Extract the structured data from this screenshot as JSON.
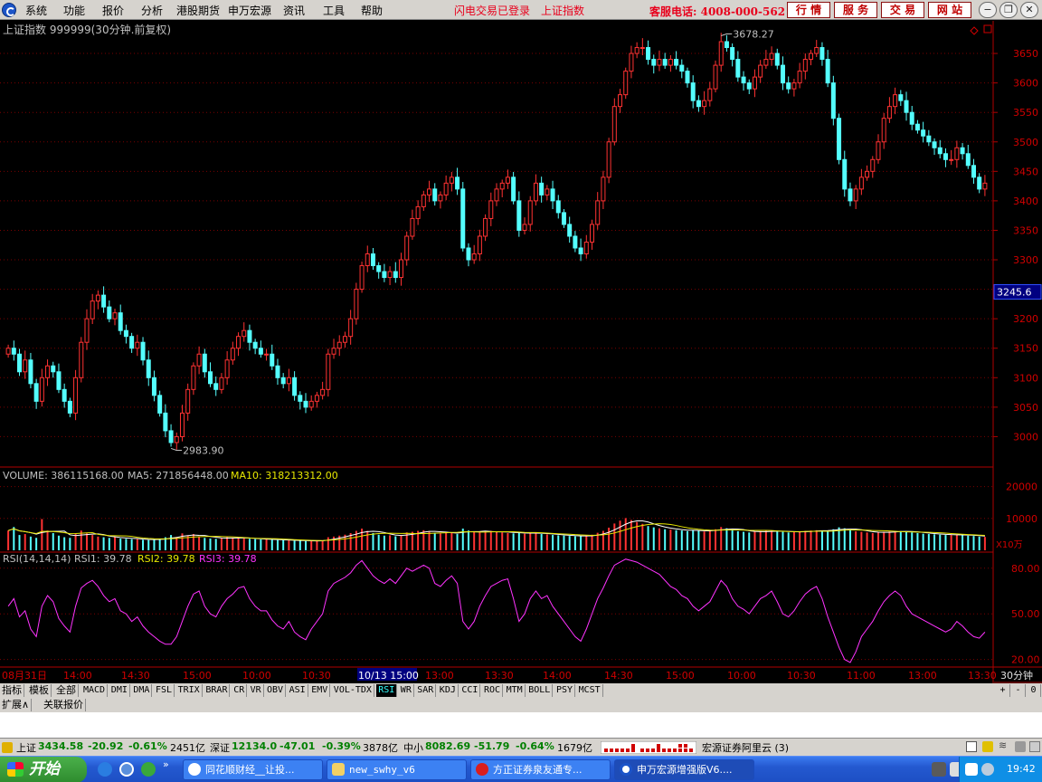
{
  "menubar": {
    "items": [
      "系统",
      "功能",
      "报价",
      "分析",
      "港股期货",
      "申万宏源",
      "资讯",
      "工具",
      "帮助"
    ],
    "flash_login": "闪电交易已登录",
    "index_link": "上证指数",
    "hotline": "客服电话: 4008-000-562",
    "buttons": [
      "行 情",
      "服 务",
      "交 易",
      "网 站"
    ]
  },
  "chart_header": {
    "title": "上证指数 999999(30分钟.前复权)"
  },
  "chart_data": {
    "type": "candlestick",
    "ylim": [
      2950,
      3690
    ],
    "yticks": [
      3650,
      3600,
      3550,
      3500,
      3450,
      3400,
      3350,
      3300,
      3250,
      3200,
      3150,
      3100,
      3050,
      3000
    ],
    "current_value_label": "3245.6",
    "max_label": "3678.27",
    "min_label": "2983.90",
    "x_tick_labels": [
      "08月31日",
      "14:00",
      "14:30",
      "15:00",
      "10:00",
      "10:30",
      "10/13 15:00",
      "13:00",
      "13:30",
      "14:00",
      "14:30",
      "15:00",
      "10:00",
      "10:30",
      "11:00",
      "13:00",
      "13:30"
    ],
    "closes": [
      3150,
      3140,
      3110,
      3130,
      3090,
      3060,
      3100,
      3120,
      3110,
      3080,
      3060,
      3040,
      3100,
      3160,
      3200,
      3230,
      3240,
      3220,
      3200,
      3210,
      3180,
      3170,
      3150,
      3160,
      3130,
      3100,
      3070,
      3040,
      3010,
      2990,
      3000,
      3040,
      3080,
      3120,
      3140,
      3110,
      3090,
      3080,
      3100,
      3130,
      3150,
      3170,
      3180,
      3160,
      3150,
      3140,
      3140,
      3120,
      3100,
      3090,
      3100,
      3070,
      3060,
      3050,
      3060,
      3070,
      3080,
      3140,
      3150,
      3160,
      3170,
      3200,
      3250,
      3290,
      3310,
      3290,
      3280,
      3270,
      3280,
      3270,
      3300,
      3340,
      3370,
      3390,
      3410,
      3420,
      3400,
      3410,
      3430,
      3440,
      3420,
      3320,
      3300,
      3310,
      3340,
      3370,
      3400,
      3420,
      3430,
      3440,
      3400,
      3350,
      3360,
      3400,
      3430,
      3410,
      3420,
      3400,
      3380,
      3360,
      3340,
      3320,
      3310,
      3330,
      3360,
      3400,
      3440,
      3500,
      3560,
      3580,
      3620,
      3650,
      3660,
      3660,
      3640,
      3630,
      3640,
      3630,
      3640,
      3630,
      3620,
      3600,
      3570,
      3560,
      3570,
      3590,
      3630,
      3670,
      3660,
      3640,
      3610,
      3600,
      3590,
      3610,
      3630,
      3640,
      3650,
      3630,
      3600,
      3590,
      3600,
      3620,
      3640,
      3650,
      3660,
      3640,
      3600,
      3540,
      3470,
      3420,
      3400,
      3420,
      3440,
      3450,
      3470,
      3500,
      3540,
      3560,
      3580,
      3570,
      3550,
      3530,
      3520,
      3510,
      3500,
      3490,
      3480,
      3470,
      3470,
      3490,
      3480,
      3460,
      3440,
      3420,
      3430
    ],
    "volume": {
      "label": "VOLUME: 386115168.00",
      "ma5_label": "MA5: 271856448.00",
      "ma10_label": "MA10: 318213312.00",
      "yticks": [
        20000,
        10000
      ],
      "unit_label": "X10万",
      "ylim": [
        0,
        23000
      ],
      "values": [
        6200,
        7300,
        4800,
        5100,
        4300,
        3900,
        9800,
        6200,
        5400,
        4600,
        4100,
        3900,
        5100,
        6200,
        5300,
        4800,
        4300,
        4100,
        3900,
        4100,
        3700,
        3600,
        3500,
        3500,
        3300,
        3200,
        3400,
        3600,
        4100,
        4800,
        4200,
        5300,
        4600,
        5100,
        4300,
        3900,
        3700,
        3600,
        3800,
        4100,
        4000,
        3900,
        3700,
        3600,
        3500,
        3400,
        3400,
        3300,
        3200,
        3200,
        3100,
        3000,
        3000,
        2900,
        2900,
        3000,
        3100,
        4100,
        4300,
        4600,
        4900,
        5400,
        6100,
        6800,
        6100,
        5400,
        4900,
        4600,
        4700,
        4400,
        4600,
        5600,
        5800,
        6100,
        6300,
        5900,
        5500,
        5300,
        5600,
        5400,
        5100,
        6800,
        6200,
        5700,
        5600,
        5900,
        6100,
        5700,
        5600,
        5400,
        5300,
        5600,
        5200,
        5400,
        5500,
        5100,
        5000,
        4800,
        4700,
        4600,
        4500,
        4400,
        4400,
        4600,
        4900,
        5500,
        6100,
        7100,
        8400,
        9300,
        10100,
        9500,
        8900,
        8300,
        7600,
        7200,
        6900,
        6600,
        6500,
        6300,
        6200,
        6000,
        6400,
        6200,
        5900,
        6100,
        6600,
        7300,
        6900,
        6400,
        6000,
        5800,
        5600,
        5800,
        6000,
        6100,
        6200,
        5900,
        5800,
        5600,
        5700,
        5900,
        6100,
        6200,
        6300,
        6200,
        6100,
        6600,
        7200,
        6900,
        6400,
        6000,
        5800,
        5600,
        5400,
        5600,
        5800,
        5900,
        6100,
        6000,
        5800,
        5600,
        5400,
        5200,
        5100,
        5000,
        4900,
        4800,
        4800,
        4900,
        4800,
        4600,
        4500,
        4300,
        4200
      ]
    },
    "rsi": {
      "label": "RSI(14,14,14)",
      "rsi1_label": "RSI1: 39.78",
      "rsi2_label": "RSI2: 39.78",
      "rsi3_label": "RSI3: 39.78",
      "yticks": [
        80,
        50,
        20
      ],
      "ylim": [
        15,
        90
      ],
      "values": [
        55,
        60,
        48,
        52,
        40,
        35,
        55,
        62,
        58,
        47,
        42,
        38,
        55,
        67,
        70,
        72,
        68,
        62,
        58,
        60,
        52,
        50,
        45,
        48,
        42,
        38,
        35,
        32,
        30,
        30,
        35,
        45,
        55,
        63,
        65,
        55,
        50,
        48,
        55,
        60,
        63,
        67,
        68,
        60,
        55,
        52,
        52,
        46,
        42,
        40,
        45,
        38,
        35,
        33,
        40,
        45,
        50,
        65,
        70,
        72,
        74,
        77,
        82,
        85,
        80,
        75,
        72,
        70,
        73,
        70,
        75,
        80,
        78,
        80,
        82,
        80,
        70,
        68,
        72,
        75,
        70,
        45,
        40,
        45,
        55,
        62,
        68,
        70,
        72,
        73,
        60,
        45,
        50,
        60,
        65,
        60,
        62,
        55,
        50,
        45,
        40,
        35,
        32,
        40,
        50,
        60,
        67,
        75,
        82,
        84,
        86,
        85,
        84,
        82,
        80,
        78,
        76,
        72,
        68,
        66,
        62,
        60,
        55,
        52,
        55,
        58,
        65,
        72,
        68,
        60,
        55,
        53,
        50,
        55,
        60,
        62,
        65,
        58,
        50,
        48,
        52,
        58,
        63,
        66,
        68,
        60,
        48,
        38,
        28,
        20,
        18,
        25,
        35,
        40,
        45,
        52,
        58,
        62,
        65,
        62,
        55,
        50,
        48,
        46,
        44,
        42,
        40,
        38,
        40,
        45,
        42,
        38,
        35,
        34,
        38
      ]
    }
  },
  "tabs": [
    "指标",
    "模板",
    "全部",
    "MACD",
    "DMI",
    "DMA",
    "FSL",
    "TRIX",
    "BRAR",
    "CR",
    "VR",
    "OBV",
    "ASI",
    "EMV",
    "VOL-TDX",
    "RSI",
    "WR",
    "SAR",
    "KDJ",
    "CCI",
    "ROC",
    "MTM",
    "BOLL",
    "PSY",
    "MCST"
  ],
  "tabs_selected": "RSI",
  "period_label": "30分钟",
  "right_controls": [
    "+",
    "-",
    "0"
  ],
  "ext_tabs": [
    "扩展∧",
    "关联报价"
  ],
  "statusbar": {
    "sh_name": "上证",
    "sh_value": "3434.58",
    "sh_change": "-20.92",
    "sh_pct": "-0.61%",
    "sh_amount": "2451亿",
    "sz_name": "深证",
    "sz_value": "12134.0",
    "sz_change": "-47.01",
    "sz_pct": "-0.39%",
    "sz_amount": "3878亿",
    "zx_name": "中小",
    "zx_value": "8082.69",
    "zx_change": "-51.79",
    "zx_pct": "-0.64%",
    "zx_amount": "1679亿",
    "server": "宏源证券阿里云 (3)"
  },
  "taskbar": {
    "start_label": "开始",
    "tasks": [
      "同花顺财经__让投...",
      "new_swhy_v6",
      "方正证券泉友通专...",
      "申万宏源增强版V6...."
    ],
    "clock": "19:42"
  }
}
